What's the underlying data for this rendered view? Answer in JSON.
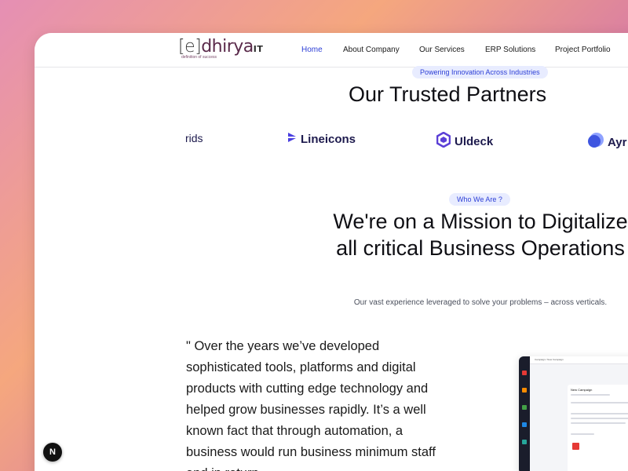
{
  "brand": {
    "logo_bracket": "[e]",
    "logo_name": "dhirya",
    "logo_suffix": "IT",
    "tagline": "definition of success"
  },
  "nav": {
    "items": [
      {
        "label": "Home",
        "active": true
      },
      {
        "label": "About Company",
        "active": false
      },
      {
        "label": "Our Services",
        "active": false
      },
      {
        "label": "ERP Solutions",
        "active": false
      },
      {
        "label": "Project Portfolio",
        "active": false
      }
    ]
  },
  "partners": {
    "badge": "Powering Innovation Across Industries",
    "title": "Our Trusted Partners",
    "logos": [
      {
        "name": "rids",
        "icon": "none"
      },
      {
        "name": "Lineicons",
        "icon": "lineicons-icon"
      },
      {
        "name": "Uldeck",
        "icon": "hexagon-icon"
      },
      {
        "name": "Ayr",
        "icon": "circle-icon"
      }
    ]
  },
  "mission": {
    "badge": "Who We Are ?",
    "title": "We're on a Mission to Digitalize all critical Business Operations",
    "subtitle": "Our vast experience leveraged to solve your problems – across verticals."
  },
  "quote": {
    "text": "\" Over the years we’ve developed sophisticated tools, platforms and digital products with cutting edge technology and helped grow businesses rapidly. It’s a well known fact that through automation, a business would run business minimum staff and in return"
  },
  "preview": {
    "breadcrumb": "Campaign / New Campaign",
    "card_title": "New Campaign"
  },
  "overlay": {
    "badge_letter": "N"
  },
  "colors": {
    "accent": "#2d3fd6",
    "pill_bg": "#e8ecff",
    "heading": "#0f0f14"
  }
}
